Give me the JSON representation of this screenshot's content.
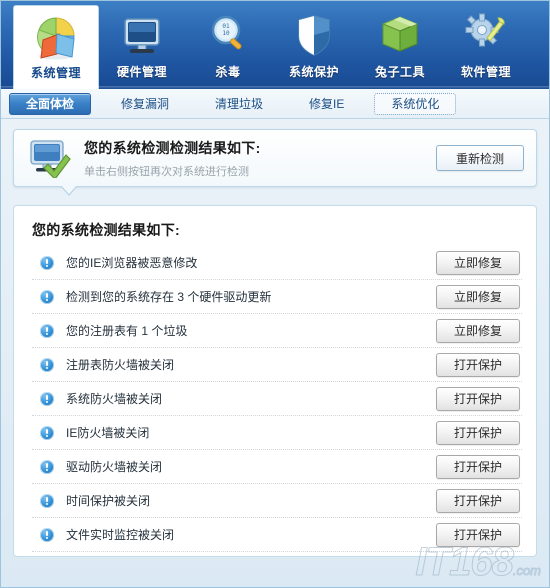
{
  "colors": {
    "header_top": "#3d7fc4",
    "header_bottom": "#184a92",
    "active_tab": "#2b6cb2",
    "card_border": "#c4dbea",
    "warn_icon": "#2f8fd6",
    "title_text": "#1a1a1a",
    "sub_text": "#9aa3ab"
  },
  "header": {
    "nav": [
      {
        "label": "系统管理",
        "icon": "pie-chart-icon",
        "active": true
      },
      {
        "label": "硬件管理",
        "icon": "monitor-icon",
        "active": false
      },
      {
        "label": "杀毒",
        "icon": "magnifier-icon",
        "active": false
      },
      {
        "label": "系统保护",
        "icon": "shield-icon",
        "active": false
      },
      {
        "label": "兔子工具",
        "icon": "green-box-icon",
        "active": false
      },
      {
        "label": "软件管理",
        "icon": "gear-wrench-icon",
        "active": false
      }
    ]
  },
  "tabbar": {
    "tabs": [
      {
        "label": "全面体检",
        "state": "active"
      },
      {
        "label": "修复漏洞",
        "state": "normal"
      },
      {
        "label": "清理垃圾",
        "state": "normal"
      },
      {
        "label": "修复IE",
        "state": "normal"
      },
      {
        "label": "系统优化",
        "state": "focused"
      }
    ]
  },
  "info_panel": {
    "icon": "monitor-check-icon",
    "title": "您的系统检测检测结果如下:",
    "subtitle": "单击右侧按钮再次对系统进行检测",
    "button_label": "重新检测"
  },
  "results": {
    "title": "您的系统检测结果如下:",
    "rows": [
      {
        "icon": "warning-info-icon",
        "label": "您的IE浏览器被恶意修改",
        "action": "立即修复"
      },
      {
        "icon": "warning-info-icon",
        "label": "检测到您的系统存在 3 个硬件驱动更新",
        "action": "立即修复"
      },
      {
        "icon": "warning-info-icon",
        "label": "您的注册表有 1 个垃圾",
        "action": "立即修复"
      },
      {
        "icon": "warning-info-icon",
        "label": "注册表防火墙被关闭",
        "action": "打开保护"
      },
      {
        "icon": "warning-info-icon",
        "label": "系统防火墙被关闭",
        "action": "打开保护"
      },
      {
        "icon": "warning-info-icon",
        "label": "IE防火墙被关闭",
        "action": "打开保护"
      },
      {
        "icon": "warning-info-icon",
        "label": "驱动防火墙被关闭",
        "action": "打开保护"
      },
      {
        "icon": "warning-info-icon",
        "label": "时间保护被关闭",
        "action": "打开保护"
      },
      {
        "icon": "warning-info-icon",
        "label": "文件实时监控被关闭",
        "action": "打开保护"
      }
    ]
  },
  "watermark": {
    "text": "IT168",
    "suffix": ".com"
  }
}
